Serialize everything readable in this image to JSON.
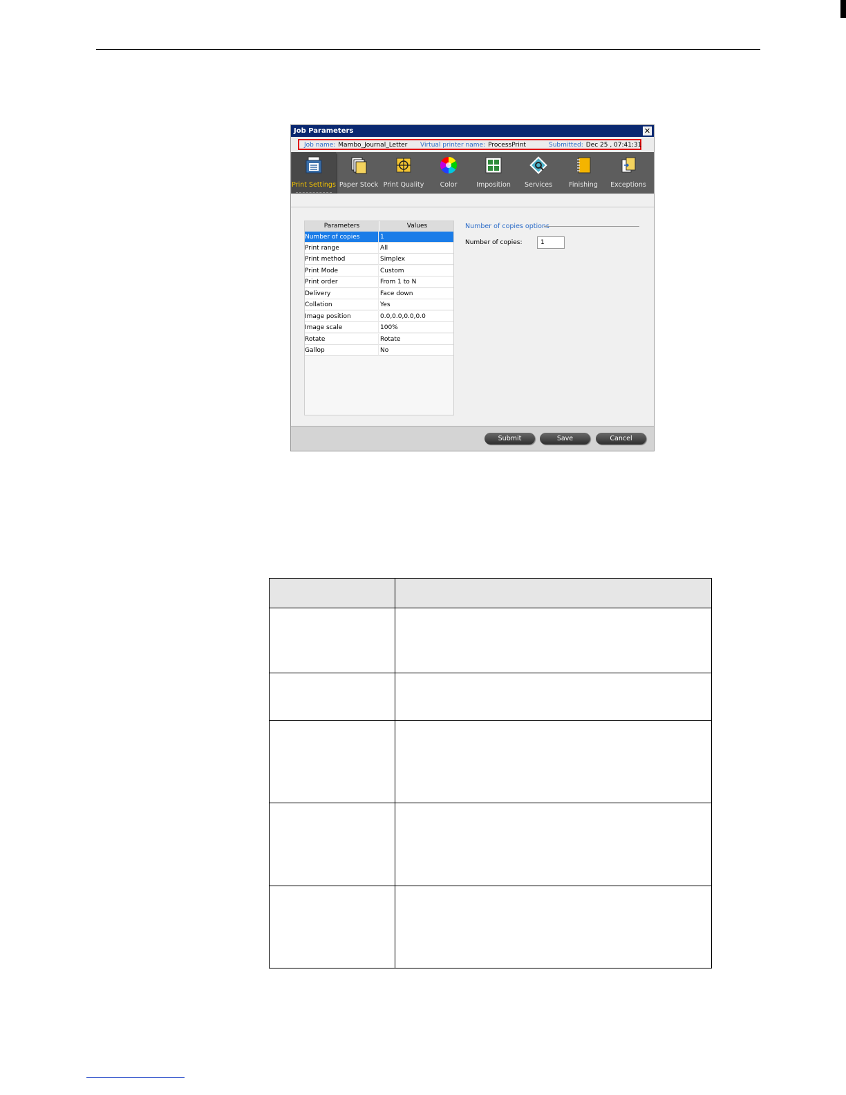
{
  "dialog": {
    "title": "Job Parameters",
    "close_glyph": "✕",
    "info": {
      "job_name_label": "Job name:",
      "job_name_value": "Mambo_Journal_Letter",
      "printer_label": "Virtual printer name:",
      "printer_value": "ProcessPrint",
      "submitted_label": "Submitted:",
      "submitted_value": "Dec 25 , 07:41:31"
    },
    "tabs": [
      {
        "label": "Print Settings",
        "icon": "print-settings-icon",
        "active": true
      },
      {
        "label": "Paper Stock",
        "icon": "paper-stock-icon"
      },
      {
        "label": "Print Quality",
        "icon": "print-quality-icon"
      },
      {
        "label": "Color",
        "icon": "color-wheel-icon"
      },
      {
        "label": "Imposition",
        "icon": "imposition-icon"
      },
      {
        "label": "Services",
        "icon": "services-icon"
      },
      {
        "label": "Finishing",
        "icon": "finishing-icon"
      },
      {
        "label": "Exceptions",
        "icon": "exceptions-icon"
      }
    ],
    "params_table": {
      "headers": [
        "Parameters",
        "Values"
      ],
      "rows": [
        {
          "param": "Number of copies",
          "value": "1",
          "selected": true
        },
        {
          "param": "Print range",
          "value": "All"
        },
        {
          "param": "Print method",
          "value": "Simplex"
        },
        {
          "param": "Print Mode",
          "value": "Custom"
        },
        {
          "param": "Print order",
          "value": "From 1 to N"
        },
        {
          "param": "Delivery",
          "value": "Face down"
        },
        {
          "param": "Collation",
          "value": "Yes"
        },
        {
          "param": "Image position",
          "value": "0.0,0.0,0.0,0.0"
        },
        {
          "param": "Image scale",
          "value": "100%"
        },
        {
          "param": "Rotate",
          "value": "Rotate"
        },
        {
          "param": "Gallop",
          "value": "No"
        }
      ]
    },
    "copies_panel": {
      "title": "Number of copies options",
      "field_label": "Number of copies:",
      "field_value": "1"
    },
    "buttons": {
      "submit": "Submit",
      "save": "Save",
      "cancel": "Cancel"
    }
  },
  "colors": {
    "titlebar": "#0a2870",
    "highlight_border": "#e00000",
    "selected_row": "#1a7ce8",
    "active_tab_label": "#f2c200",
    "info_label": "#2a6bc8"
  }
}
